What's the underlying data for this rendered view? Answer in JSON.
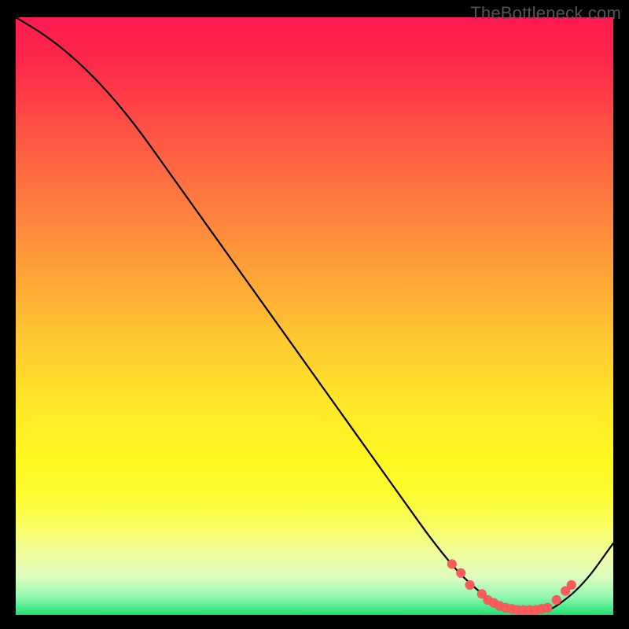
{
  "watermark": "TheBottleneck.com",
  "chart_data": {
    "type": "line",
    "title": "",
    "xlabel": "",
    "ylabel": "",
    "xlim": [
      0,
      100
    ],
    "ylim": [
      0,
      100
    ],
    "series": [
      {
        "name": "bottleneck-curve",
        "x": [
          0,
          5,
          10,
          15,
          20,
          25,
          30,
          35,
          40,
          45,
          50,
          55,
          60,
          65,
          70,
          75,
          80,
          82,
          85,
          88,
          90,
          95,
          100
        ],
        "y": [
          100,
          97,
          93,
          88,
          82,
          75,
          68,
          61,
          54,
          47,
          40,
          33,
          26,
          19,
          12,
          6,
          2,
          1,
          0.5,
          0.5,
          1,
          5,
          12
        ]
      }
    ],
    "highlight_points": {
      "name": "sweet-spot-dots",
      "x": [
        73,
        74.5,
        76,
        78,
        79,
        80,
        81,
        82,
        83,
        84,
        85,
        86,
        87,
        88,
        89,
        90.5,
        92,
        93
      ],
      "y": [
        8.5,
        7,
        5,
        3.5,
        2.5,
        2,
        1.5,
        1.2,
        1,
        0.8,
        0.8,
        0.8,
        0.8,
        1,
        1.2,
        2.5,
        4,
        5
      ]
    }
  }
}
